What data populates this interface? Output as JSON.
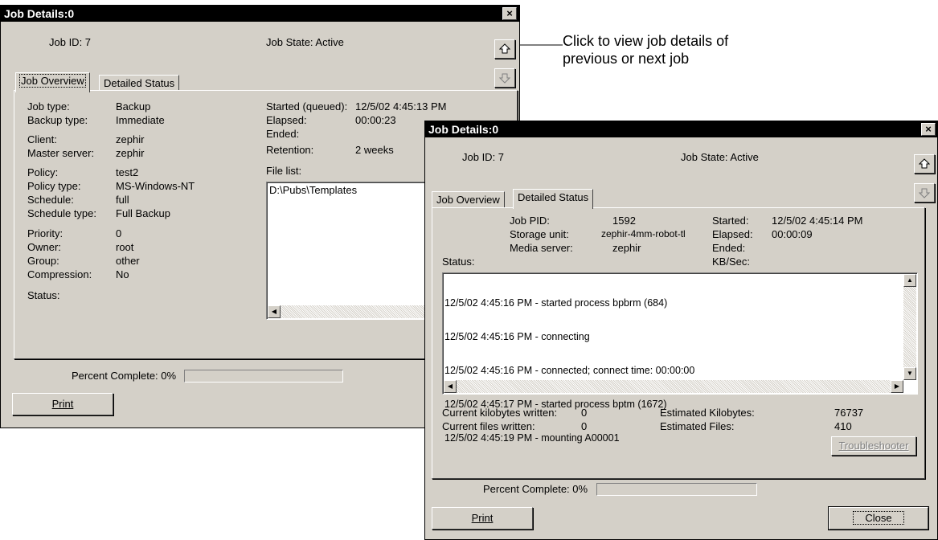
{
  "callout": {
    "line1": "Click to view job details of",
    "line2": "previous or next job"
  },
  "window1": {
    "title": "Job Details:0",
    "job_id": "Job ID: 7",
    "job_state": "Job State: Active",
    "tabs": [
      "Job Overview",
      "Detailed Status"
    ],
    "left_fields": [
      {
        "label": "Job type:",
        "value": "Backup"
      },
      {
        "label": "Backup type:",
        "value": "Immediate"
      },
      {
        "label": "Client:",
        "value": "zephir"
      },
      {
        "label": "Master server:",
        "value": "zephir"
      },
      {
        "label": "Policy:",
        "value": "test2"
      },
      {
        "label": "Policy type:",
        "value": "MS-Windows-NT"
      },
      {
        "label": "Schedule:",
        "value": "full"
      },
      {
        "label": "Schedule type:",
        "value": "Full Backup"
      },
      {
        "label": "Priority:",
        "value": "0"
      },
      {
        "label": "Owner:",
        "value": "root"
      },
      {
        "label": "Group:",
        "value": "other"
      },
      {
        "label": "Compression:",
        "value": "No"
      },
      {
        "label": "Status:",
        "value": ""
      }
    ],
    "right_fields": [
      {
        "label": "Started (queued):",
        "value": "12/5/02 4:45:13 PM"
      },
      {
        "label": "Elapsed:",
        "value": "00:00:23"
      },
      {
        "label": "Ended:",
        "value": ""
      },
      {
        "label": "Retention:",
        "value": "2 weeks"
      }
    ],
    "file_list_label": "File list:",
    "file_list": [
      "D:\\Pubs\\Templates"
    ],
    "percent_complete": "Percent Complete: 0%",
    "progress": 0,
    "print_label": "Print"
  },
  "window2": {
    "title": "Job Details:0",
    "job_id": "Job ID: 7",
    "job_state": "Job State: Active",
    "tabs": [
      "Job Overview",
      "Detailed Status"
    ],
    "info_left": [
      {
        "label": "Job PID:",
        "value": "1592"
      },
      {
        "label": "Storage unit:",
        "value": "zephir-4mm-robot-tl"
      },
      {
        "label": "Media server:",
        "value": "zephir"
      }
    ],
    "info_right": [
      {
        "label": "Started:",
        "value": "12/5/02 4:45:14 PM"
      },
      {
        "label": "Elapsed:",
        "value": "00:00:09"
      },
      {
        "label": "Ended:",
        "value": ""
      },
      {
        "label": "KB/Sec:",
        "value": ""
      }
    ],
    "status_label": "Status:",
    "log": [
      "12/5/02 4:45:16 PM - started process bpbrm (684)",
      "12/5/02 4:45:16 PM - connecting",
      "12/5/02 4:45:16 PM - connected; connect time: 00:00:00",
      "12/5/02 4:45:17 PM - started process bptm (1672)",
      "12/5/02 4:45:19 PM - mounting A00001"
    ],
    "kb_written_label": "Current kilobytes written:",
    "kb_written": "0",
    "files_written_label": "Current files written:",
    "files_written": "0",
    "est_kb_label": "Estimated Kilobytes:",
    "est_kb": "76737",
    "est_files_label": "Estimated Files:",
    "est_files": "410",
    "troubleshooter_label": "Troubleshooter",
    "percent_complete": "Percent Complete: 0%",
    "progress": 0,
    "print_label": "Print",
    "close_label": "Close"
  }
}
